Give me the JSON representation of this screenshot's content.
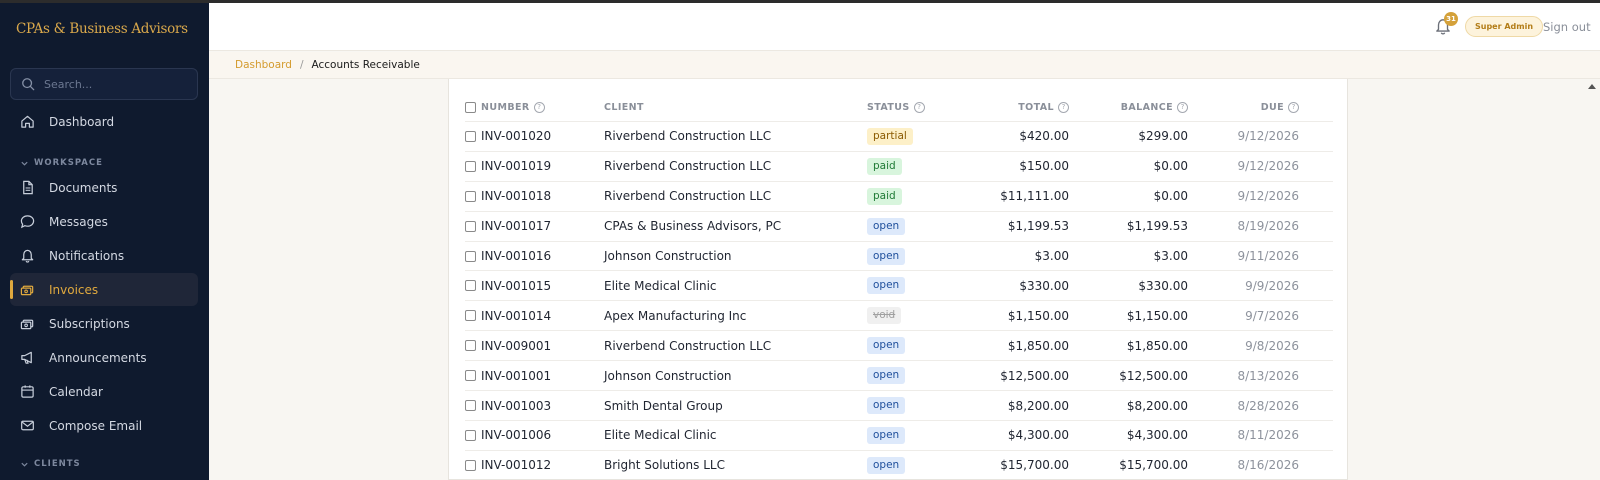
{
  "brand": {
    "name": "CPAs & Business Advisors"
  },
  "search": {
    "placeholder": "Search..."
  },
  "nav": {
    "dashboard": "Dashboard",
    "workspace_label": "WORKSPACE",
    "items": [
      {
        "label": "Documents",
        "icon": "document-icon"
      },
      {
        "label": "Messages",
        "icon": "message-icon"
      },
      {
        "label": "Notifications",
        "icon": "bell-icon"
      },
      {
        "label": "Invoices",
        "icon": "invoice-icon",
        "active": true
      },
      {
        "label": "Subscriptions",
        "icon": "subscription-icon"
      },
      {
        "label": "Announcements",
        "icon": "megaphone-icon"
      },
      {
        "label": "Calendar",
        "icon": "calendar-icon"
      },
      {
        "label": "Compose Email",
        "icon": "mail-icon"
      }
    ],
    "clients_label": "CLIENTS"
  },
  "header": {
    "notification_count": "31",
    "role": "Super Admin",
    "signout": "Sign out"
  },
  "breadcrumb": {
    "parent": "Dashboard",
    "separator": "/",
    "current": "Accounts Receivable"
  },
  "table": {
    "headers": {
      "number": "NUMBER",
      "client": "CLIENT",
      "status": "STATUS",
      "total": "TOTAL",
      "balance": "BALANCE",
      "due": "DUE"
    },
    "help_glyph": "?",
    "rows": [
      {
        "number": "INV-001020",
        "client": "Riverbend Construction LLC",
        "status": "partial",
        "total": "$420.00",
        "balance": "$299.00",
        "due": "9/12/2026"
      },
      {
        "number": "INV-001019",
        "client": "Riverbend Construction LLC",
        "status": "paid",
        "total": "$150.00",
        "balance": "$0.00",
        "due": "9/12/2026"
      },
      {
        "number": "INV-001018",
        "client": "Riverbend Construction LLC",
        "status": "paid",
        "total": "$11,111.00",
        "balance": "$0.00",
        "due": "9/12/2026"
      },
      {
        "number": "INV-001017",
        "client": "CPAs & Business Advisors, PC",
        "status": "open",
        "total": "$1,199.53",
        "balance": "$1,199.53",
        "due": "8/19/2026"
      },
      {
        "number": "INV-001016",
        "client": "Johnson Construction",
        "status": "open",
        "total": "$3.00",
        "balance": "$3.00",
        "due": "9/11/2026"
      },
      {
        "number": "INV-001015",
        "client": "Elite Medical Clinic",
        "status": "open",
        "total": "$330.00",
        "balance": "$330.00",
        "due": "9/9/2026"
      },
      {
        "number": "INV-001014",
        "client": "Apex Manufacturing Inc",
        "status": "void",
        "total": "$1,150.00",
        "balance": "$1,150.00",
        "due": "9/7/2026"
      },
      {
        "number": "INV-009001",
        "client": "Riverbend Construction LLC",
        "status": "open",
        "total": "$1,850.00",
        "balance": "$1,850.00",
        "due": "9/8/2026"
      },
      {
        "number": "INV-001001",
        "client": "Johnson Construction",
        "status": "open",
        "total": "$12,500.00",
        "balance": "$12,500.00",
        "due": "8/13/2026"
      },
      {
        "number": "INV-001003",
        "client": "Smith Dental Group",
        "status": "open",
        "total": "$8,200.00",
        "balance": "$8,200.00",
        "due": "8/28/2026"
      },
      {
        "number": "INV-001006",
        "client": "Elite Medical Clinic",
        "status": "open",
        "total": "$4,300.00",
        "balance": "$4,300.00",
        "due": "8/11/2026"
      },
      {
        "number": "INV-001012",
        "client": "Bright Solutions LLC",
        "status": "open",
        "total": "$15,700.00",
        "balance": "$15,700.00",
        "due": "8/16/2026"
      }
    ]
  },
  "colors": {
    "sidebar": "#0f1a2e",
    "accent": "#d49b2e",
    "active_text": "#e0a93e"
  }
}
